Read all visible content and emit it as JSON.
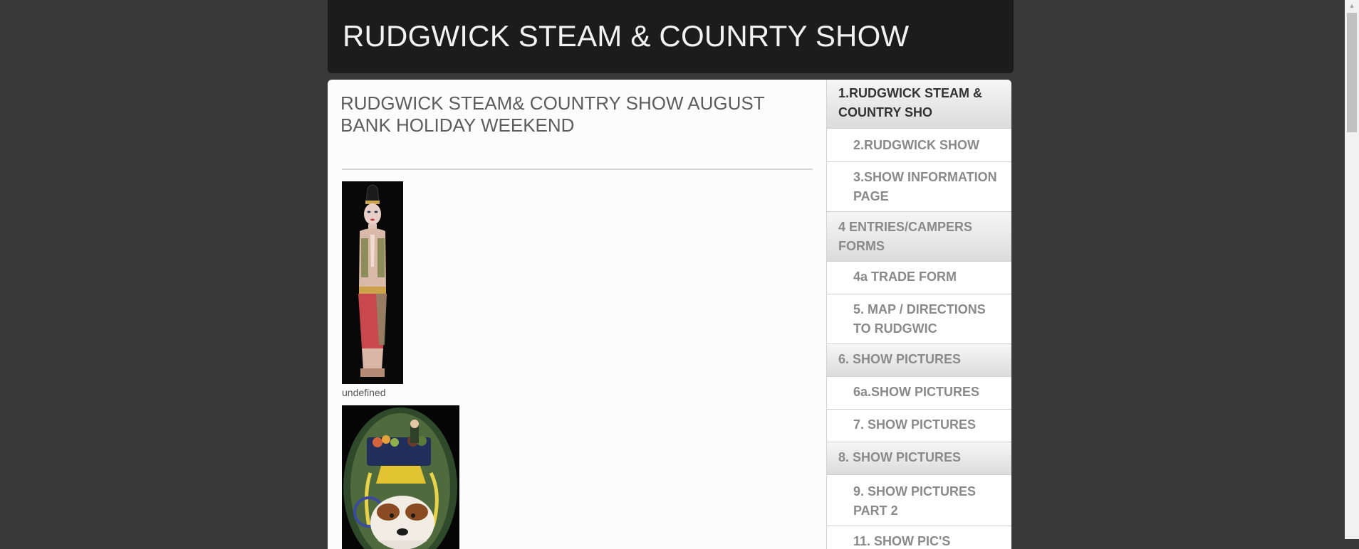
{
  "site": {
    "title": "RUDGWICK STEAM & COUNRTY SHOW"
  },
  "main": {
    "heading": "RUDGWICK STEAM& COUNTRY SHOW AUGUST BANK HOLIDAY WEEKEND",
    "images": [
      {
        "caption": "undefined"
      }
    ]
  },
  "nav": {
    "items": [
      {
        "label": "1.RUDGWICK STEAM & COUNTRY SHO"
      },
      {
        "label": "2.RUDGWICK SHOW"
      },
      {
        "label": "3.SHOW INFORMATION PAGE"
      },
      {
        "label": "4 ENTRIES/CAMPERS FORMS"
      },
      {
        "label": "4a TRADE FORM"
      },
      {
        "label": "5. MAP / DIRECTIONS TO RUDGWIC"
      },
      {
        "label": "6. SHOW PICTURES"
      },
      {
        "label": "6a.SHOW PICTURES"
      },
      {
        "label": "7. SHOW PICTURES"
      },
      {
        "label": "8. SHOW PICTURES"
      },
      {
        "label": "9. SHOW PICTURES PART 2"
      },
      {
        "label": "11. SHOW PIC'S"
      }
    ]
  },
  "colors": {
    "page_background": "#393939",
    "header_background": "#1c1c1c",
    "nav_text": "#8a8a8a",
    "nav_active_text": "#333333"
  }
}
